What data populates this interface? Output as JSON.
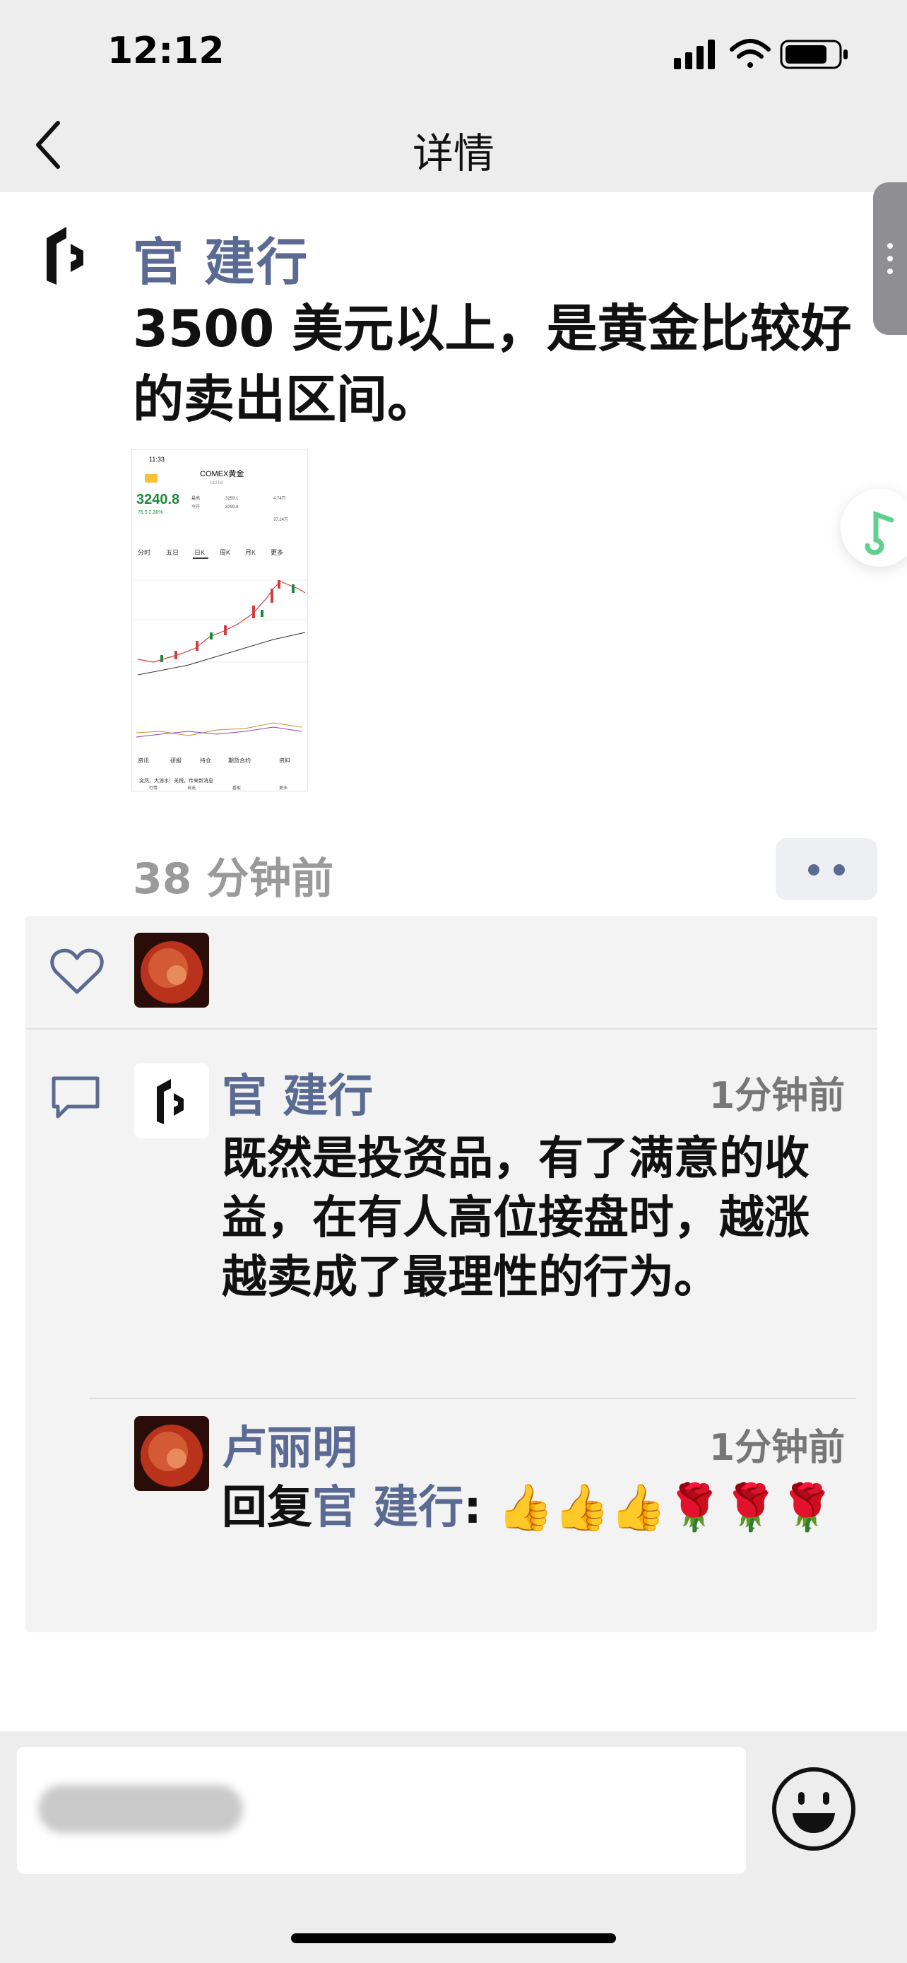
{
  "status_bar": {
    "time": "12:12"
  },
  "nav": {
    "title": "详情"
  },
  "post": {
    "author": "官 建行",
    "text": "3500 美元以上，是黄金比较好的卖出区间。",
    "time": "38 分钟前",
    "image": {
      "time": "11:33",
      "title": "COMEX黄金",
      "code": "GCUM",
      "price": "3240.8",
      "change": "76.5  2.36%",
      "stat_labels": [
        "最高",
        "今开",
        "成交",
        "持仓"
      ],
      "stat_values": [
        "3259.1",
        "3299.8",
        "4.74万",
        "37.24万"
      ],
      "tabs": [
        "分时",
        "五日",
        "日K",
        "周K",
        "月K",
        "更多"
      ],
      "bottom_tabs": [
        "资讯",
        "研报",
        "持仓",
        "期货合约",
        "资料"
      ],
      "news": "突然，大消水！关税，传来新消息",
      "nav": [
        "行情",
        "自选",
        "看板",
        "更多"
      ]
    }
  },
  "likes": {
    "count_visible": 1
  },
  "comments": [
    {
      "author": "官 建行",
      "time": "1分钟前",
      "text": "既然是投资品，有了满意的收益，在有人高位接盘时，越涨越卖成了最理性的行为。"
    },
    {
      "author": "卢丽明",
      "time": "1分钟前",
      "reply_prefix": "回复",
      "reply_to": "官 建行",
      "reply_suffix": ":",
      "emoji": "👍👍👍🌹🌹🌹"
    }
  ],
  "colors": {
    "name": "#5a6a92",
    "time": "#9a9a9a",
    "panel": "#f3f3f3"
  }
}
